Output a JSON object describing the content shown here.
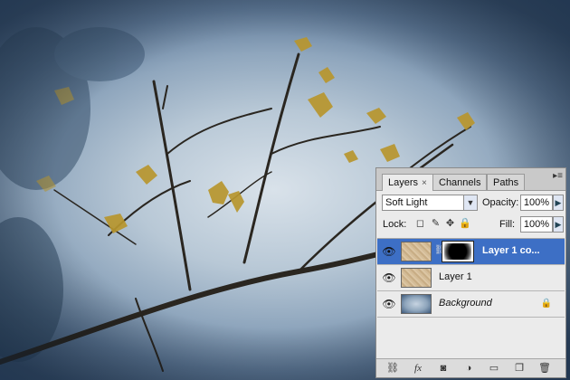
{
  "panel": {
    "tabs": [
      {
        "label": "Layers",
        "close": "×"
      },
      {
        "label": "Channels"
      },
      {
        "label": "Paths"
      }
    ],
    "menu_icon": "panel-menu-icon",
    "blend_mode": "Soft Light",
    "opacity_label": "Opacity:",
    "opacity_value": "100%",
    "lock_label": "Lock:",
    "fill_label": "Fill:",
    "fill_value": "100%",
    "layers": [
      {
        "name": "Layer 1 co...",
        "selected": true,
        "has_mask": true
      },
      {
        "name": "Layer 1",
        "selected": false
      },
      {
        "name": "Background",
        "selected": false,
        "locked": true
      }
    ]
  },
  "icons": {
    "eye": "eye-icon",
    "link": "link-icon",
    "fx": "fx",
    "lock": "lock-icon"
  },
  "colors": {
    "selection": "#3d6fc5",
    "panel_bg": "#ebebeb",
    "leaf": "#b8962e"
  }
}
